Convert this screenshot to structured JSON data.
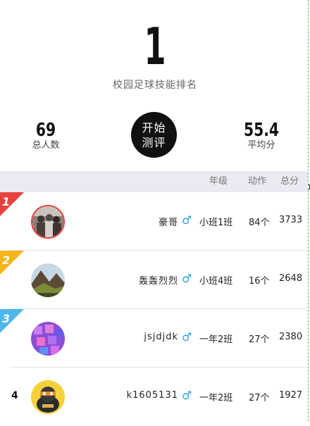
{
  "header": {
    "rank": "1",
    "title": "校园足球技能排名"
  },
  "stats": {
    "total_people": {
      "value": "69",
      "label": "总人数"
    },
    "average_score": {
      "value": "55.4",
      "label": "平均分"
    }
  },
  "start_button": {
    "label": "开始测评"
  },
  "table": {
    "columns": {
      "grade": "年级",
      "actions": "动作",
      "total": "总分"
    },
    "rows": [
      {
        "rank": "1",
        "name": "豪哥",
        "gender_icon": "male-icon",
        "class": "小班1班",
        "actions": "84个",
        "score": "3733",
        "flag_color": "#e8423f",
        "avatar_icon": "group-photo-icon"
      },
      {
        "rank": "2",
        "name": "轰轰烈烈",
        "gender_icon": "male-icon",
        "class": "小班4班",
        "actions": "16个",
        "score": "2648",
        "flag_color": "#f2b51c",
        "avatar_icon": "landscape-photo-icon"
      },
      {
        "rank": "3",
        "name": "jsjdjdk",
        "gender_icon": "male-icon",
        "class": "一年2班",
        "actions": "27个",
        "score": "2380",
        "flag_color": "#4db6ea",
        "avatar_icon": "purple-pattern-icon"
      },
      {
        "rank": "4",
        "name": "k1605131",
        "gender_icon": "male-icon",
        "class": "一年2班",
        "actions": "27个",
        "score": "1927",
        "flag_color": "",
        "avatar_icon": "cartoon-character-icon"
      }
    ]
  },
  "symbols": {
    "male": "♂"
  }
}
